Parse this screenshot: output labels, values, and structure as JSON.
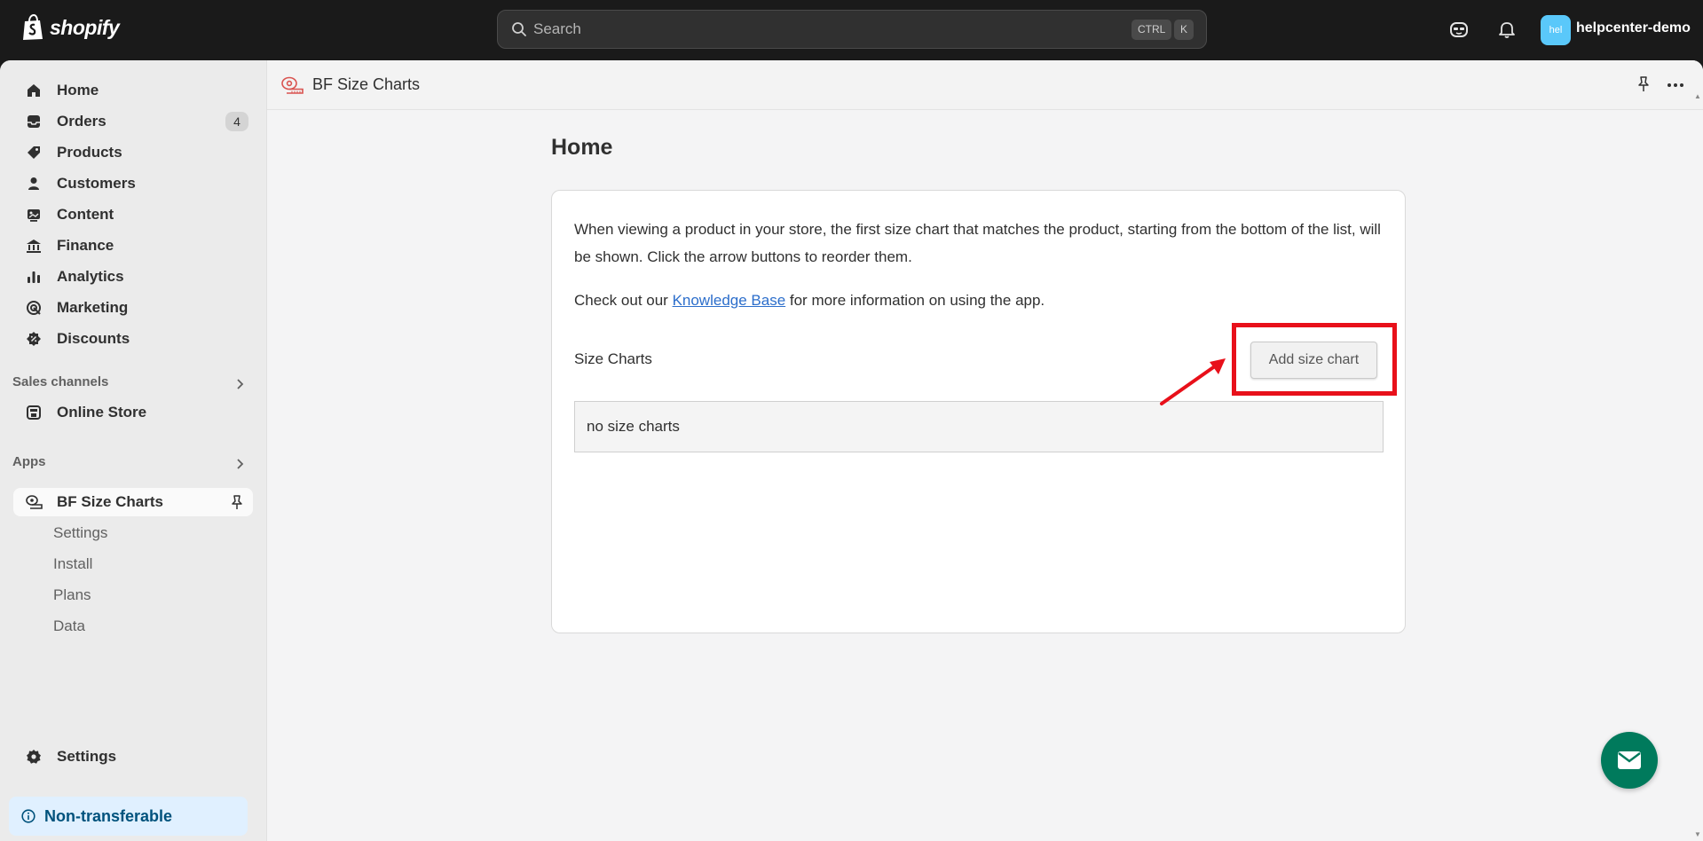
{
  "topbar": {
    "brand": "shopify",
    "search_placeholder": "Search",
    "shortcut_ctrl": "CTRL",
    "shortcut_k": "K",
    "avatar_initials": "hel",
    "store_name": "helpcenter-demo"
  },
  "sidebar": {
    "items": [
      {
        "label": "Home",
        "icon": "home-icon"
      },
      {
        "label": "Orders",
        "icon": "orders-icon",
        "badge": "4"
      },
      {
        "label": "Products",
        "icon": "tag-icon"
      },
      {
        "label": "Customers",
        "icon": "person-icon"
      },
      {
        "label": "Content",
        "icon": "content-icon"
      },
      {
        "label": "Finance",
        "icon": "bank-icon"
      },
      {
        "label": "Analytics",
        "icon": "bar-chart-icon"
      },
      {
        "label": "Marketing",
        "icon": "target-icon"
      },
      {
        "label": "Discounts",
        "icon": "discount-icon"
      }
    ],
    "sales_channels_heading": "Sales channels",
    "online_store": "Online Store",
    "apps_heading": "Apps",
    "app_name": "BF Size Charts",
    "app_subitems": [
      "Settings",
      "Install",
      "Plans",
      "Data"
    ],
    "settings": "Settings",
    "non_transferable": "Non-transferable"
  },
  "main": {
    "app_title": "BF Size Charts",
    "page_title": "Home",
    "description": "When viewing a product in your store, the first size chart that matches the product, starting from the bottom of the list, will be shown. Click the arrow buttons to reorder them.",
    "kb_prefix": "Check out our ",
    "kb_link": "Knowledge Base",
    "kb_suffix": " for more information on using the app.",
    "size_charts_label": "Size Charts",
    "add_button": "Add size chart",
    "empty_text": "no size charts"
  },
  "colors": {
    "highlight": "#e8101a",
    "fab": "#007a5c",
    "link": "#2c6ecb",
    "avatar": "#5ac8fa"
  }
}
